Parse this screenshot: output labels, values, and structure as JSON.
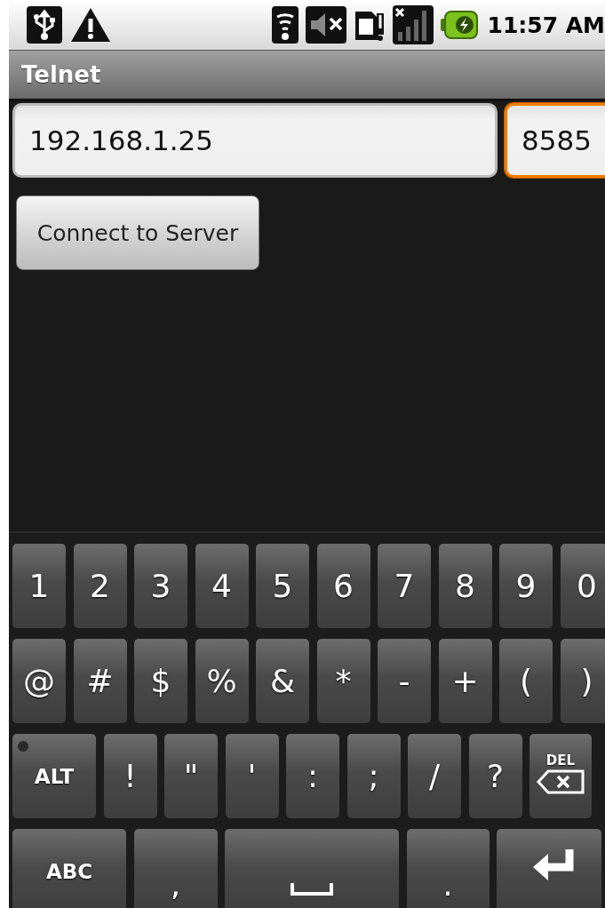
{
  "status_bar": {
    "time": "11:57 AM"
  },
  "title_bar": {
    "title": "Telnet"
  },
  "fields": [
    {
      "kind": "host",
      "value": "192.168.1.25",
      "focused": false
    },
    {
      "kind": "port",
      "value": "8585",
      "focused": true
    }
  ],
  "connect_button": {
    "label": "Connect to Server"
  },
  "keyboard": {
    "rows": [
      [
        {
          "kind": "char",
          "label": "1"
        },
        {
          "kind": "char",
          "label": "2"
        },
        {
          "kind": "char",
          "label": "3"
        },
        {
          "kind": "char",
          "label": "4"
        },
        {
          "kind": "char",
          "label": "5"
        },
        {
          "kind": "char",
          "label": "6"
        },
        {
          "kind": "char",
          "label": "7"
        },
        {
          "kind": "char",
          "label": "8"
        },
        {
          "kind": "char",
          "label": "9"
        },
        {
          "kind": "char",
          "label": "0"
        }
      ],
      [
        {
          "kind": "char",
          "label": "@"
        },
        {
          "kind": "char",
          "label": "#"
        },
        {
          "kind": "char",
          "label": "$"
        },
        {
          "kind": "char",
          "label": "%"
        },
        {
          "kind": "char",
          "label": "&"
        },
        {
          "kind": "char",
          "label": "*"
        },
        {
          "kind": "char",
          "label": "-"
        },
        {
          "kind": "char",
          "label": "+"
        },
        {
          "kind": "char",
          "label": "("
        },
        {
          "kind": "char",
          "label": ")"
        }
      ],
      [
        {
          "kind": "alt",
          "label": "ALT",
          "locked": false
        },
        {
          "kind": "char",
          "label": "!"
        },
        {
          "kind": "char",
          "label": "\""
        },
        {
          "kind": "char",
          "label": "'"
        },
        {
          "kind": "char",
          "label": ":"
        },
        {
          "kind": "char",
          "label": ";"
        },
        {
          "kind": "char",
          "label": "/"
        },
        {
          "kind": "char",
          "label": "?"
        },
        {
          "kind": "del",
          "label": "DEL"
        }
      ],
      [
        {
          "kind": "mode",
          "label": "ABC"
        },
        {
          "kind": "char",
          "label": ","
        },
        {
          "kind": "space"
        },
        {
          "kind": "char",
          "label": "."
        },
        {
          "kind": "enter"
        }
      ]
    ]
  }
}
